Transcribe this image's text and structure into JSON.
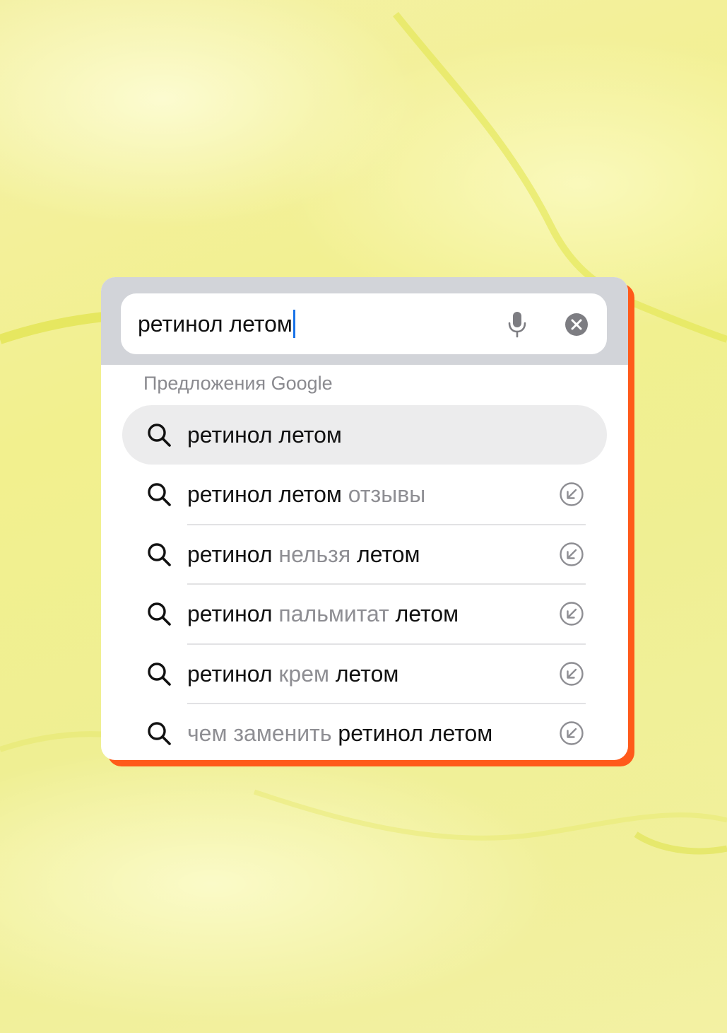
{
  "search": {
    "query": "ретинол летом",
    "mic_icon": "microphone-icon",
    "clear_icon": "clear-circle-icon"
  },
  "suggestions_header": "Предложения Google",
  "suggestions": [
    {
      "parts": [
        {
          "text": "ретинол летом",
          "muted": false
        }
      ],
      "highlighted": true
    },
    {
      "parts": [
        {
          "text": "ретинол летом ",
          "muted": false
        },
        {
          "text": "отзывы",
          "muted": true
        }
      ],
      "highlighted": false
    },
    {
      "parts": [
        {
          "text": "ретинол ",
          "muted": false
        },
        {
          "text": "нельзя ",
          "muted": true
        },
        {
          "text": "летом",
          "muted": false
        }
      ],
      "highlighted": false
    },
    {
      "parts": [
        {
          "text": "ретинол ",
          "muted": false
        },
        {
          "text": "пальмитат ",
          "muted": true
        },
        {
          "text": "летом",
          "muted": false
        }
      ],
      "highlighted": false
    },
    {
      "parts": [
        {
          "text": "ретинол ",
          "muted": false
        },
        {
          "text": "крем ",
          "muted": true
        },
        {
          "text": "летом",
          "muted": false
        }
      ],
      "highlighted": false
    },
    {
      "parts": [
        {
          "text": "чем заменить ",
          "muted": true
        },
        {
          "text": "ретинол летом",
          "muted": false
        }
      ],
      "highlighted": false
    }
  ],
  "colors": {
    "accent_shadow": "#ff5a1a",
    "caret": "#1a73e8",
    "background": "#f2f08e"
  }
}
